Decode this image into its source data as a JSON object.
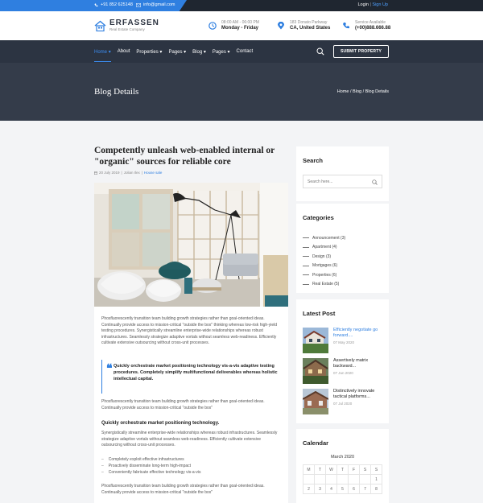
{
  "topbar": {
    "phone": "+91 852 625148",
    "email": "info@gmail.com",
    "login": "Login",
    "separator": "|",
    "signup": "Sign Up"
  },
  "header": {
    "logo_name": "ERFASSEN",
    "logo_tagline": "Real Estate Company",
    "hours_line1": "08:00 AM - 06:00 PM",
    "hours_line2": "Monday - Friday",
    "address_line1": "183 Donato Parkway",
    "address_line2": "CA, United States",
    "service_line1": "Service Available",
    "service_line2": "(+00)888.666.88"
  },
  "nav": {
    "items": [
      {
        "label": "Home",
        "dropdown": true
      },
      {
        "label": "About",
        "dropdown": false
      },
      {
        "label": "Properties",
        "dropdown": true
      },
      {
        "label": "Pages",
        "dropdown": true
      },
      {
        "label": "Blog",
        "dropdown": true
      },
      {
        "label": "Pages",
        "dropdown": true
      },
      {
        "label": "Contact",
        "dropdown": false
      }
    ],
    "submit_label": "SUBMIT PROPERTY"
  },
  "page_title": {
    "title": "Blog Details",
    "breadcrumb": "Home / Blog / Blog Details"
  },
  "article": {
    "title": "Competently unleash web-enabled internal or \"organic\" sources for reliable core",
    "date": "20 July 2019",
    "author": "Jolian Ilex",
    "category": "House sale",
    "para1": "Phosfluorescently transition team building growth strategies rather than goal-oriented ideas. Continually provide access to mission-critical \"outside the box\" thinking whereas low-risk high-yield testing procedures. Synergistically streamline enterprise-wide relationships whereas robust infrastructures. Seamlessly strategize adaptive vortals without seamless web-readiness. Efficiently cultivate extensive outsourcing without cross-unit processes.",
    "quote": "Quickly orchestrate market positioning technology vis-a-vis adaptive testing procedures. Completely simplify multifunctional deliverables whereas holistic intellectual capital.",
    "para2": "Phosfluorescently transition team building growth strategies rather than goal-oriented ideas. Continually provide access to mission-critical \"outside the box\"",
    "subheading": "Quickly orchestrate market positioning technology.",
    "para3": "Synergistically streamline enterprise-wide relationships whereas robust infrastructures. Seamlessly strategize adaptive vortals without seamless web-readiness. Efficiently cultivate extensive outsourcing without cross-unit processes.",
    "bullets": [
      "Completely exploit effective infrastructures",
      "Proactively disseminate long-term high-impact",
      "Conveniently fabricate effective technology vis-a-vis"
    ],
    "para4": "Phosfluorescently transition team building growth strategies rather than goal-oriented ideas. Continually provide access to mission-critical \"outside the box\""
  },
  "sidebar": {
    "search_title": "Search",
    "search_placeholder": "Search here...",
    "categories_title": "Categories",
    "categories": [
      "Announcement (3)",
      "Apartment (4)",
      "Design (3)",
      "Mortgages (6)",
      "Properties (6)",
      "Real Estate (5)"
    ],
    "latest_title": "Latest Post",
    "posts": [
      {
        "title": "Efficiently negotiate go forward....",
        "date": "07 May 2020"
      },
      {
        "title": "Assertively matrix backward...",
        "date": "07 Jun 2020"
      },
      {
        "title": "Distinctively innovate tactical platforms...",
        "date": "07 Jul 2020"
      }
    ],
    "calendar_title": "Calendar",
    "calendar_month": "March 2020",
    "calendar_header": [
      "M",
      "T",
      "W",
      "T",
      "F",
      "S",
      "S"
    ],
    "calendar_row1": [
      "",
      "",
      "",
      "",
      "",
      "",
      "1"
    ],
    "calendar_row2": [
      "2",
      "3",
      "4",
      "5",
      "6",
      "7",
      "8"
    ]
  },
  "colors": {
    "accent": "#2f7fe0",
    "nav_bg": "#2c3442",
    "band_bg": "#343c4a"
  }
}
